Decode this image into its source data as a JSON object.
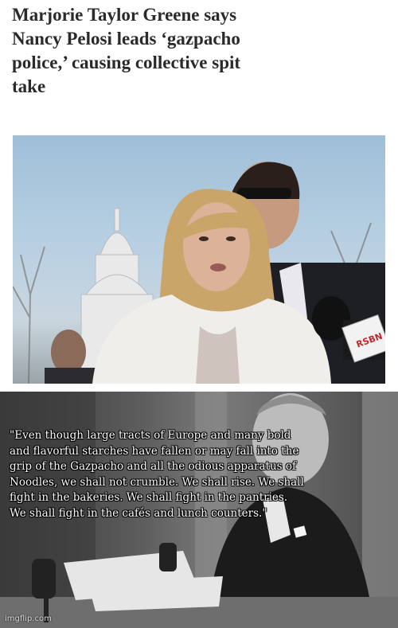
{
  "headline": "Marjorie Taylor Greene says Nancy Pelosi leads ‘gazpacho police,’ causing collective spit take",
  "top_photo": {
    "alt": "photo-of-woman-in-fur-coat-with-man-behind-capitol-dome",
    "sky_color": "#a9c4dc",
    "coat_color": "#efeeea",
    "hair_color": "#c9a56a",
    "mic_logo": "mic-flag-logo"
  },
  "bottom_photo": {
    "alt": "black-and-white-photo-of-man-at-desk-with-microphones"
  },
  "quote": "\"Even though large tracts of Europe and many bold and flavorful starches have fallen or may fall into the grip of the Gazpacho and all the odious apparatus of Noodles, we shall not crumble. We shall rise. We shall fight in the bakeries. We shall fight in the pantries. We shall fight in the cafés and lunch counters.\"",
  "watermark": "imgflip.com"
}
